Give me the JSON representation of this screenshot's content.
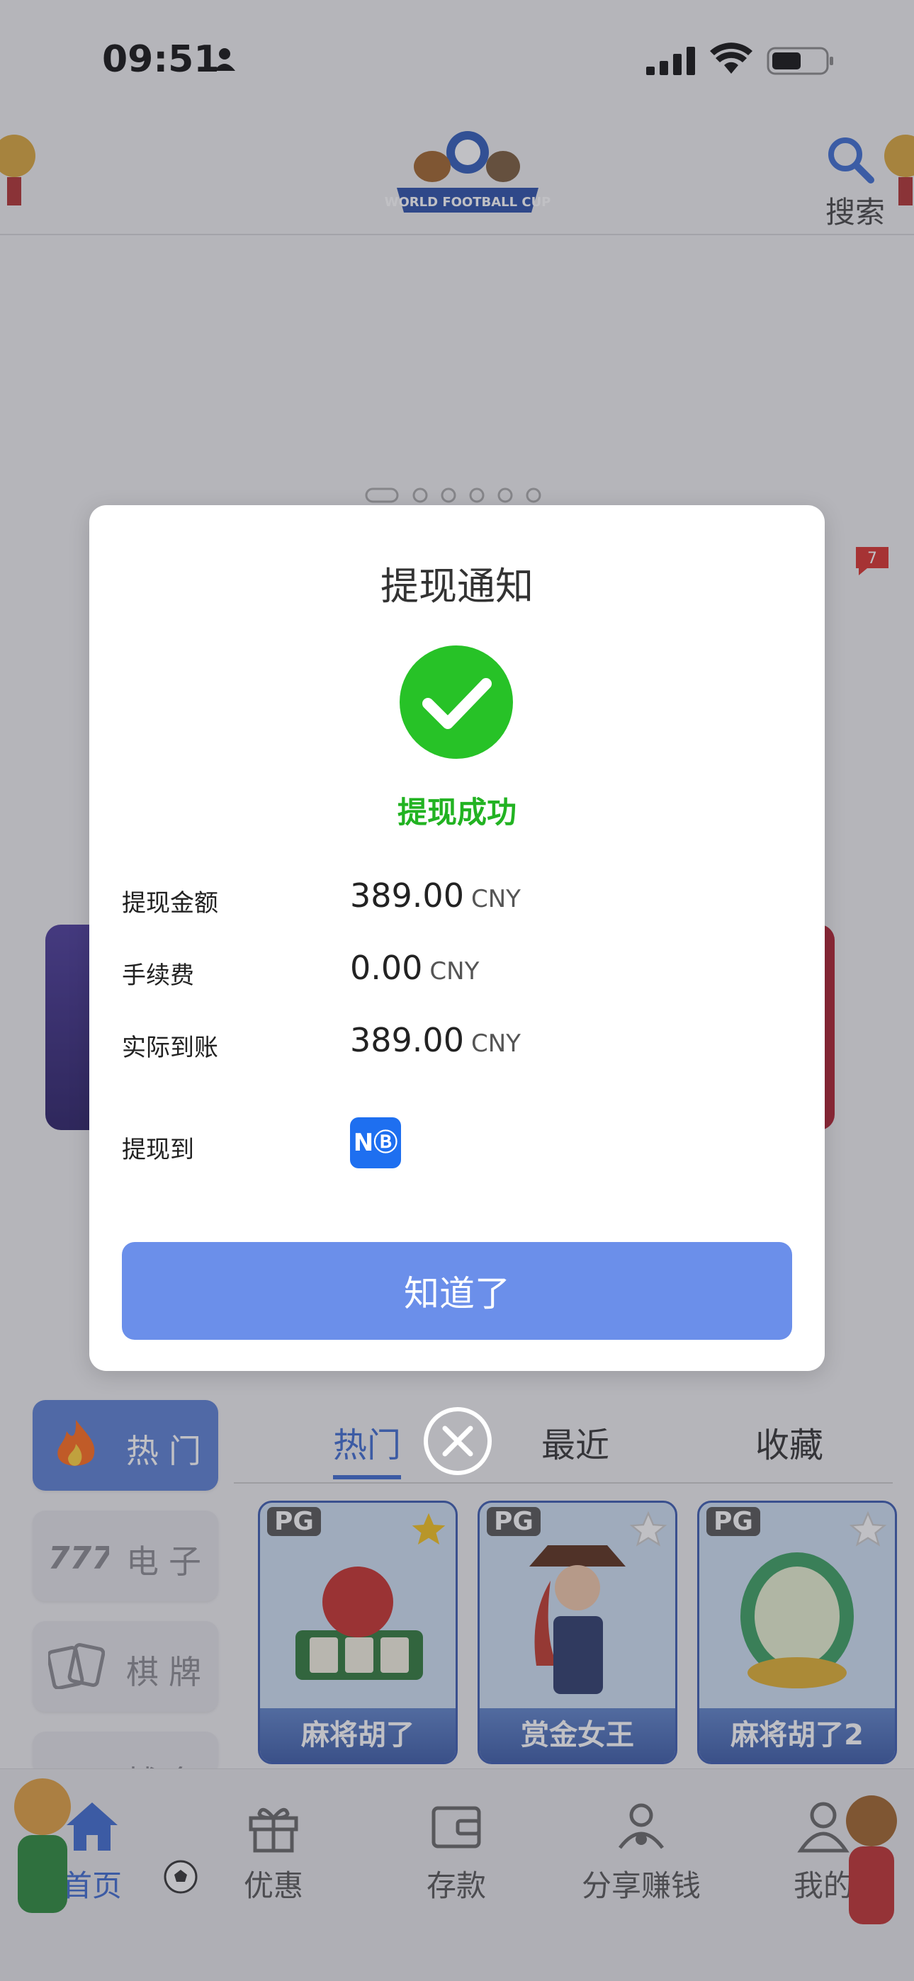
{
  "status_bar": {
    "time": "09:51"
  },
  "header": {
    "search_label": "搜索",
    "logo_text": "WORLD FOOTBALL CUP"
  },
  "side_tabs": [
    {
      "label": "热门",
      "active": true
    },
    {
      "label": "电子",
      "active": false
    },
    {
      "label": "棋牌",
      "active": false
    },
    {
      "label": "捕鱼",
      "active": false
    }
  ],
  "main_tabs": [
    {
      "label": "热门",
      "active": true
    },
    {
      "label": "最近",
      "active": false
    },
    {
      "label": "收藏",
      "active": false
    }
  ],
  "games": [
    {
      "provider": "PG",
      "name": "麻将胡了",
      "favorited": true
    },
    {
      "provider": "PG",
      "name": "赏金女王",
      "favorited": false
    },
    {
      "provider": "PG",
      "name": "麻将胡了2",
      "favorited": false
    }
  ],
  "notification_badge": "7",
  "bottom_nav": [
    {
      "label": "首页",
      "icon": "home-icon",
      "active": true
    },
    {
      "label": "优惠",
      "icon": "gift-icon",
      "active": false
    },
    {
      "label": "存款",
      "icon": "wallet-icon",
      "active": false
    },
    {
      "label": "分享赚钱",
      "icon": "share-icon",
      "active": false
    },
    {
      "label": "我的",
      "icon": "profile-icon",
      "active": false
    }
  ],
  "modal": {
    "title": "提现通知",
    "status": "提现成功",
    "rows": [
      {
        "label": "提现金额",
        "value": "389.00",
        "unit": "CNY"
      },
      {
        "label": "手续费",
        "value": "0.00",
        "unit": "CNY"
      },
      {
        "label": "实际到账",
        "value": "389.00",
        "unit": "CNY"
      }
    ],
    "withdraw_to_label": "提现到",
    "withdraw_to_badge": "NⒷ",
    "confirm_label": "知道了"
  },
  "colors": {
    "accent": "#6b8fea",
    "success": "#22b322",
    "active_tab": "#3d6ad0"
  }
}
